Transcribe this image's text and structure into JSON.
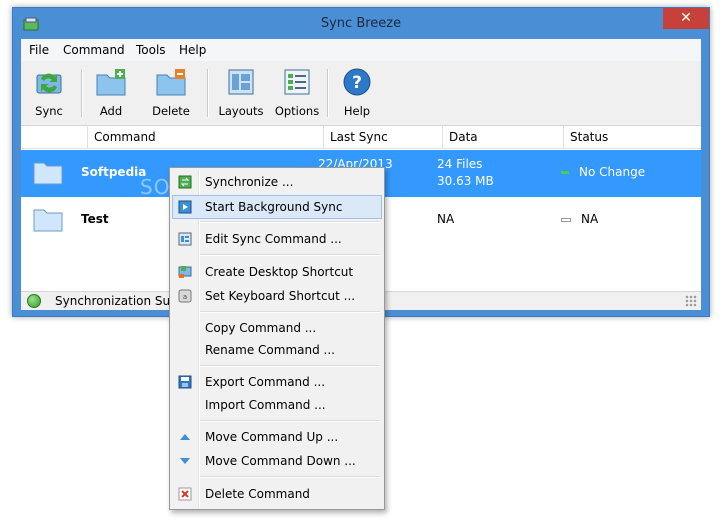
{
  "window": {
    "title": "Sync Breeze",
    "close": "✕"
  },
  "menubar": {
    "items": [
      "File",
      "Command",
      "Tools",
      "Help"
    ]
  },
  "toolbar": {
    "buttons": [
      "Sync",
      "Add",
      "Delete",
      "Layouts",
      "Options",
      "Help"
    ]
  },
  "list": {
    "columns": [
      "Command",
      "Last Sync",
      "Data",
      "Status"
    ],
    "rows": [
      {
        "name": "Softpedia",
        "last_sync": "22/Apr/2013",
        "data": "24 Files",
        "data2": "30.63 MB",
        "status": "No Change",
        "status_color": "#49d04a"
      },
      {
        "name": "Test",
        "last_sync": "",
        "data": "NA",
        "data2": "",
        "status": "NA",
        "status_color": "#b0b0b0"
      }
    ]
  },
  "statusbar": {
    "text": "Synchronization Successful"
  },
  "watermark": "SOFTPEDIA",
  "context_menu": {
    "items": [
      "Synchronize ...",
      "Start Background Sync",
      "Edit Sync Command ...",
      "Create Desktop Shortcut",
      "Set Keyboard Shortcut ...",
      "Copy Command ...",
      "Rename Command ...",
      "Export Command ...",
      "Import Command ...",
      "Move Command Up ...",
      "Move Command Down ...",
      "Delete Command"
    ]
  },
  "colors": {
    "titlebar": "#4a8fd6",
    "selection": "#3399ff",
    "close": "#c7413a"
  }
}
